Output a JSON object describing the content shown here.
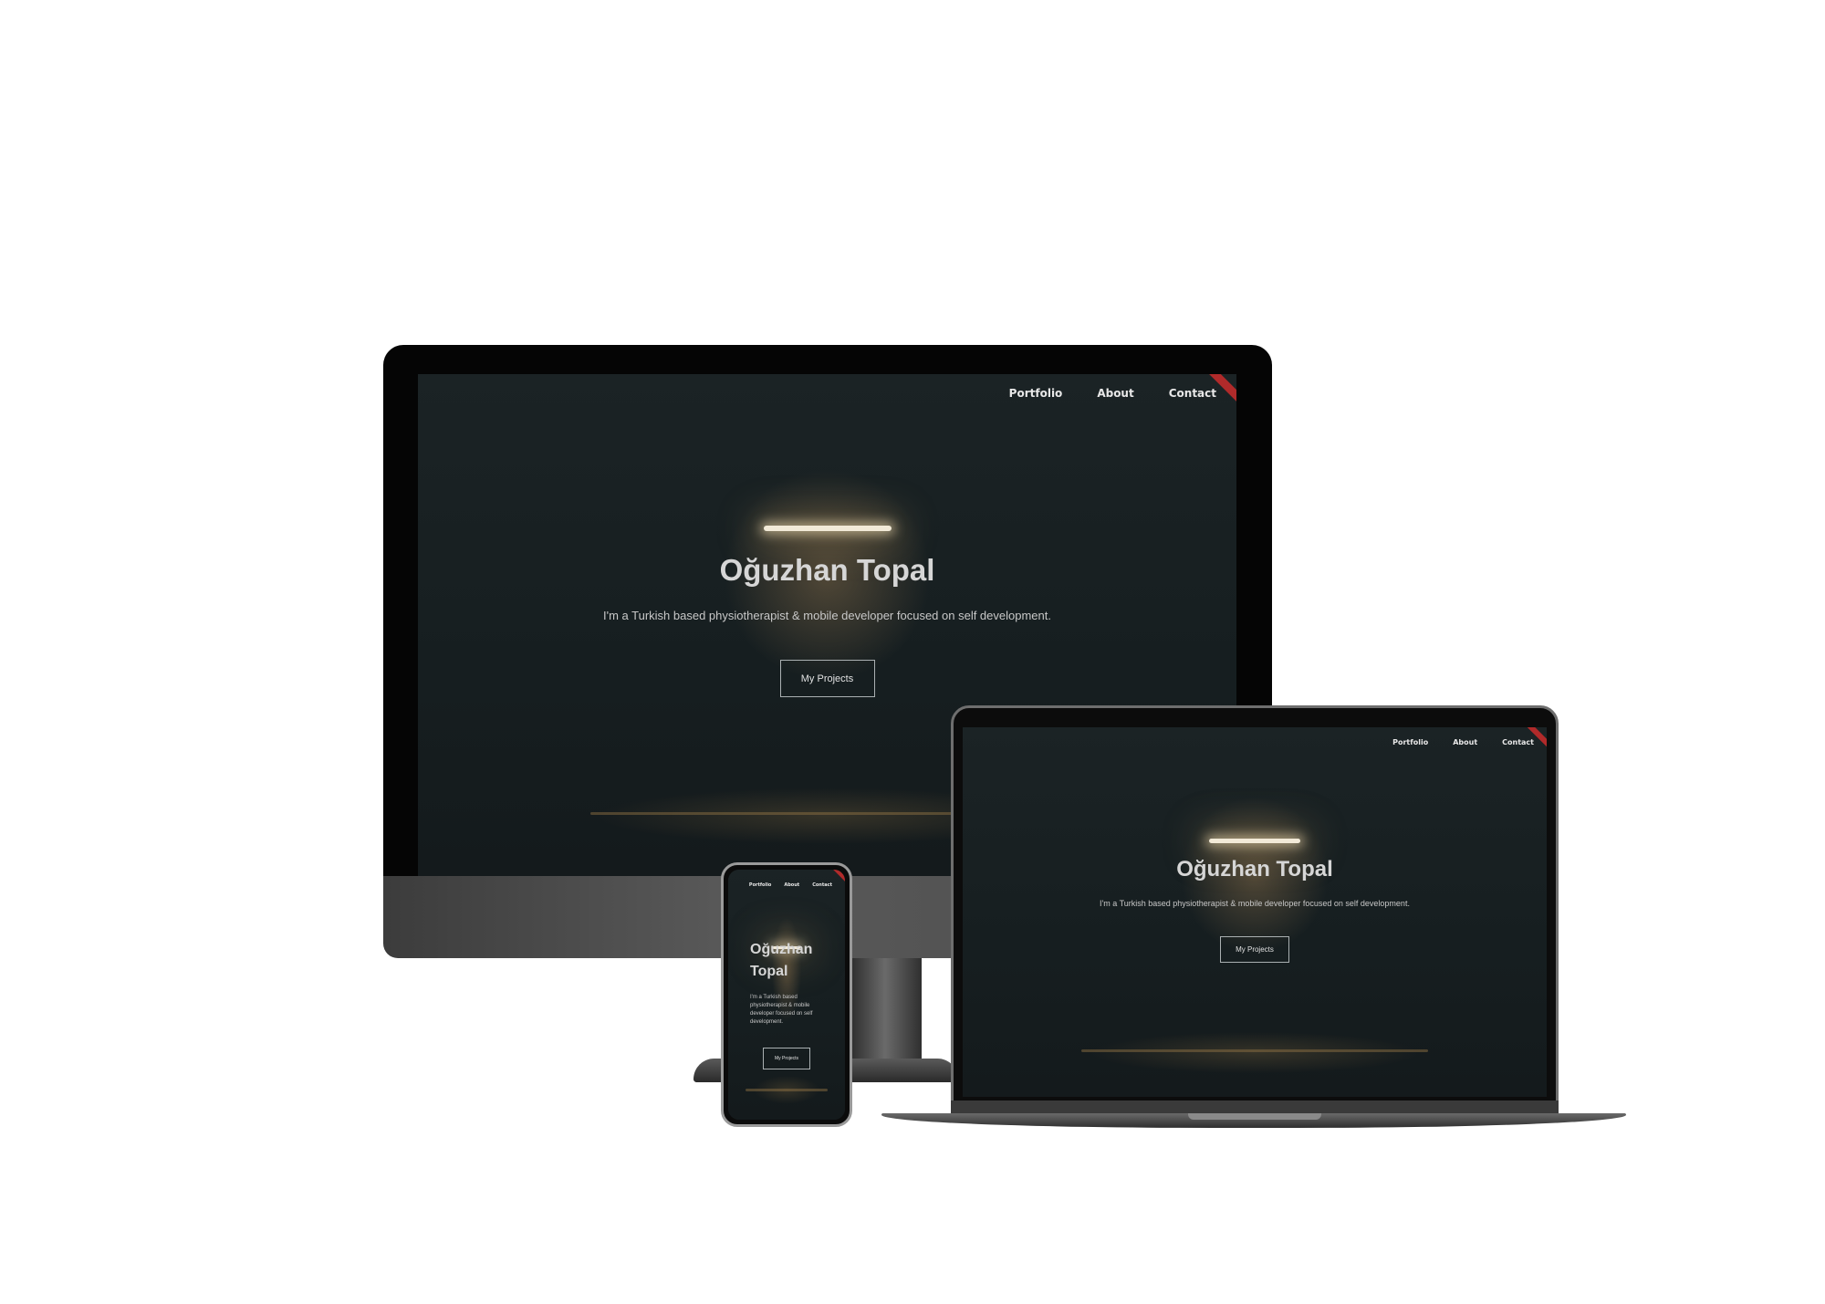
{
  "site": {
    "nav": [
      "Portfolio",
      "About",
      "Contact"
    ],
    "title": "Oğuzhan Topal",
    "title_line1": "Oğuzhan",
    "title_line2": "Topal",
    "subtitle": "I'm a Turkish based physiotherapist & mobile developer focused on self development.",
    "button": "My Projects"
  },
  "colors": {
    "background": "#182022",
    "accent_ribbon": "#b02a2a",
    "text": "#d6d6d6"
  }
}
